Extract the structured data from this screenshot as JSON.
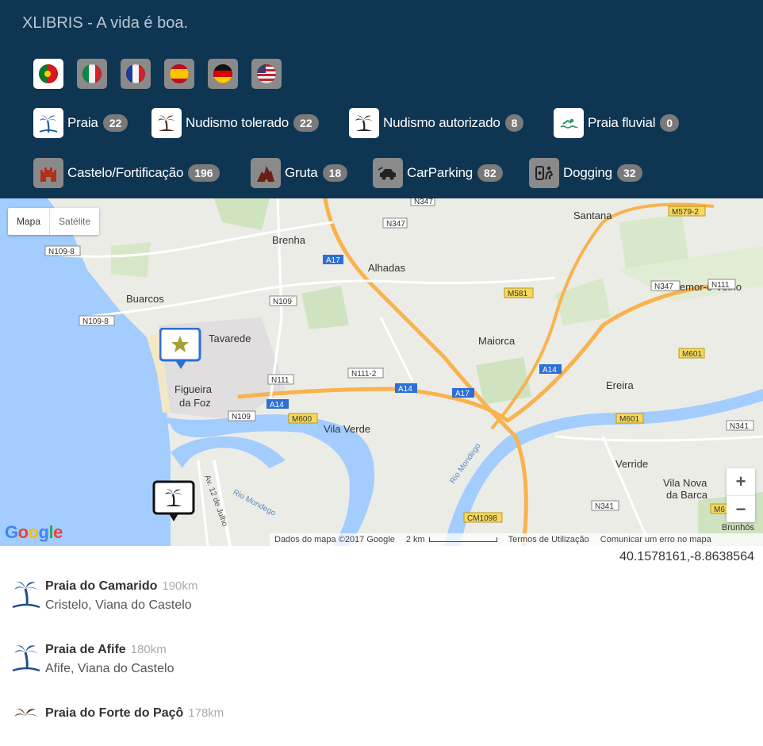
{
  "header": {
    "title": "XLIBRIS - A vida é boa.",
    "languages": [
      {
        "code": "pt",
        "icon": "flag-portugal-icon",
        "active": true
      },
      {
        "code": "it",
        "icon": "flag-italy-icon",
        "active": false
      },
      {
        "code": "fr",
        "icon": "flag-france-icon",
        "active": false
      },
      {
        "code": "es",
        "icon": "flag-spain-icon",
        "active": false
      },
      {
        "code": "de",
        "icon": "flag-germany-icon",
        "active": false
      },
      {
        "code": "us",
        "icon": "flag-usa-icon",
        "active": false
      }
    ],
    "categories": [
      {
        "label": "Praia",
        "count": "22",
        "icon": "palm-beach-icon",
        "active": true
      },
      {
        "label": "Nudismo tolerado",
        "count": "22",
        "icon": "palm-island-icon",
        "active": true
      },
      {
        "label": "Nudismo autorizado",
        "count": "8",
        "icon": "palm-island-icon",
        "active": true
      },
      {
        "label": "Praia fluvial",
        "count": "0",
        "icon": "swimmer-icon",
        "active": true
      },
      {
        "label": "Castelo/Fortificação",
        "count": "196",
        "icon": "castle-icon",
        "active": false
      },
      {
        "label": "Gruta",
        "count": "18",
        "icon": "cave-icon",
        "active": false
      },
      {
        "label": "CarParking",
        "count": "82",
        "icon": "car-icon",
        "active": false
      },
      {
        "label": "Dogging",
        "count": "32",
        "icon": "dogging-icon",
        "active": false
      }
    ]
  },
  "map": {
    "type_buttons": {
      "map": "Mapa",
      "satellite": "Satélite"
    },
    "zoom_in": "+",
    "zoom_out": "−",
    "logo": "Google",
    "footer": {
      "data": "Dados do mapa ©2017 Google",
      "scale": "2 km",
      "terms": "Termos de Utilização",
      "report": "Comunicar um erro no mapa"
    },
    "places": [
      "Santana",
      "Brenha",
      "Alhadas",
      "Buarcos",
      "Montemor-o-Velho",
      "Tavarede",
      "Maiorca",
      "Figueira",
      "da Foz",
      "Ereira",
      "Vila Verde",
      "Verride",
      "Vila Nova",
      "da Barca",
      "Brunhós"
    ],
    "road_labels": [
      "N347",
      "N347",
      "M579-2",
      "N109-8",
      "A17",
      "N347",
      "N111",
      "M581",
      "N109",
      "N109-8",
      "M601",
      "A14",
      "N111-2",
      "N111",
      "A14",
      "A17",
      "A14",
      "M600",
      "N109",
      "M601",
      "N341",
      "N341",
      "CM1098",
      "M6"
    ],
    "water_labels": [
      "Rio Mondego",
      "Rio Mondego",
      "Av. 12 de Julho"
    ],
    "colors": {
      "header": "#0e3552",
      "sea": "#a3ccff",
      "land": "#ececE6",
      "highway": "#f9b24d"
    }
  },
  "coordinates": "40.1578161,-8.8638564",
  "results": [
    {
      "name": "Praia do Camarido",
      "distance": "190km",
      "location": "Cristelo, Viana do Castelo",
      "icon": "palm-beach-icon"
    },
    {
      "name": "Praia de Afife",
      "distance": "180km",
      "location": "Afife, Viana do Castelo",
      "icon": "palm-beach-icon"
    },
    {
      "name": "Praia do Forte do Paçô",
      "distance": "178km",
      "location": "",
      "icon": "palm-island-icon"
    }
  ]
}
